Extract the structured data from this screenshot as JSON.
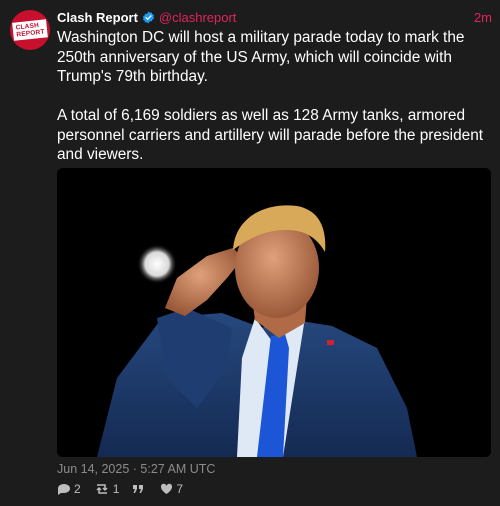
{
  "tweet": {
    "author_name": "Clash Report",
    "handle": "@clashreport",
    "relative_time": "2m",
    "avatar_text": "CLASH\nREPORT",
    "paragraphs": [
      "Washington DC will host a military parade today to mark the 250th anniversary of the US Army, which will coincide with Trump's 79th birthday.",
      "A total of 6,169 soldiers as well as 128 Army tanks, armored personnel carriers and artillery will parade before the president and viewers."
    ],
    "timestamp": "Jun 14, 2025 · 5:27 AM UTC",
    "stats": {
      "replies": "2",
      "retweets": "1",
      "quotes": "",
      "likes": "7"
    }
  },
  "colors": {
    "background": "#1c1c1c",
    "accent": "#e0245e",
    "verified": "#1d9bf0",
    "avatar_bg": "#c8102e"
  },
  "icons": [
    "verified-badge-icon",
    "reply-icon",
    "retweet-icon",
    "quote-icon",
    "like-icon"
  ]
}
